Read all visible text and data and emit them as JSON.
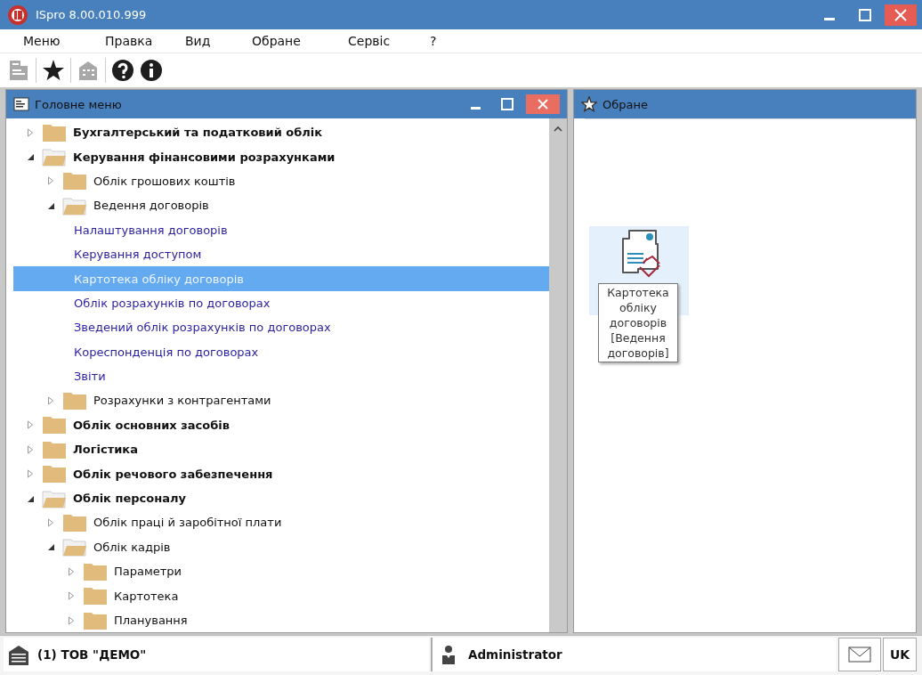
{
  "window": {
    "title": "ISpro 8.00.010.999"
  },
  "menu": [
    "Меню",
    "Правка",
    "Вид",
    "Обране",
    "Сервіс",
    "?"
  ],
  "toolbar": [
    {
      "kind": "document",
      "disabled": true
    },
    {
      "kind": "star",
      "disabled": false
    },
    {
      "kind": "building",
      "disabled": true
    },
    {
      "kind": "help",
      "disabled": false
    },
    {
      "kind": "info",
      "disabled": false
    }
  ],
  "main_panel": {
    "title": "Головне меню",
    "tree": [
      {
        "label": "Бухгалтерський та податковий облік",
        "kind": "folder",
        "expanded": false,
        "selected": false
      },
      {
        "label": "Керування фінансовими розрахунками",
        "kind": "folder",
        "expanded": true,
        "selected": false,
        "children": [
          {
            "label": "Облік грошових коштів",
            "kind": "folder",
            "expanded": false,
            "selected": false
          },
          {
            "label": "Ведення договорів",
            "kind": "folder",
            "expanded": true,
            "selected": false,
            "children": [
              {
                "label": "Налаштування договорів",
                "kind": "item",
                "selected": false
              },
              {
                "label": "Керування доступом",
                "kind": "item",
                "selected": false
              },
              {
                "label": "Картотека обліку договорів",
                "kind": "item",
                "selected": true
              },
              {
                "label": "Облік розрахунків по договорах",
                "kind": "item",
                "selected": false
              },
              {
                "label": "Зведений облік розрахунків по договорах",
                "kind": "item",
                "selected": false
              },
              {
                "label": "Кореспонденція по договорах",
                "kind": "item",
                "selected": false
              },
              {
                "label": "Звіти",
                "kind": "item",
                "selected": false
              }
            ]
          },
          {
            "label": "Розрахунки з контрагентами",
            "kind": "folder",
            "expanded": false,
            "selected": false
          }
        ]
      },
      {
        "label": "Облік основних засобів",
        "kind": "folder",
        "expanded": false,
        "selected": false
      },
      {
        "label": "Логістика",
        "kind": "folder",
        "expanded": false,
        "selected": false
      },
      {
        "label": "Облік речового забезпечення",
        "kind": "folder",
        "expanded": false,
        "selected": false
      },
      {
        "label": "Облік персоналу",
        "kind": "folder",
        "expanded": true,
        "selected": false,
        "children": [
          {
            "label": "Облік праці й заробітної плати",
            "kind": "folder",
            "expanded": false,
            "selected": false
          },
          {
            "label": "Облік кадрів",
            "kind": "folder",
            "expanded": true,
            "selected": false,
            "children": [
              {
                "label": "Параметри",
                "kind": "folder",
                "expanded": false,
                "selected": false
              },
              {
                "label": "Картотека",
                "kind": "folder",
                "expanded": false,
                "selected": false
              },
              {
                "label": "Планування",
                "kind": "folder",
                "expanded": false,
                "selected": false
              }
            ]
          }
        ]
      }
    ]
  },
  "favorites_panel": {
    "title": "Обране",
    "items": [
      {
        "label": "Картотека обліку договорів [Ведення договорів]"
      }
    ]
  },
  "status_bar": {
    "organization": "(1) ТОВ \"ДЕМО\"",
    "user": "Administrator",
    "language": "UK"
  }
}
